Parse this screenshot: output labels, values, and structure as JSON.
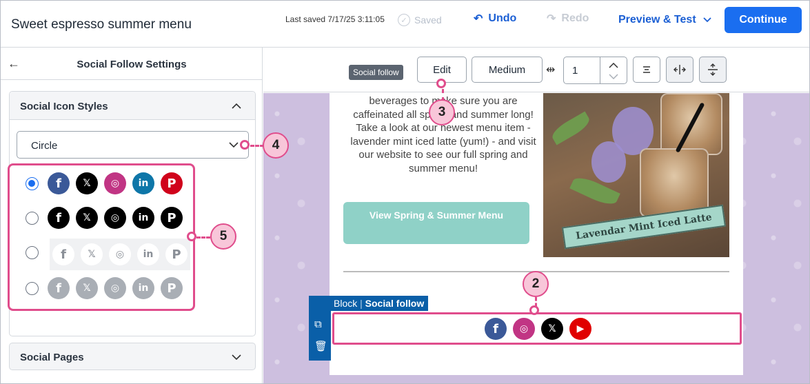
{
  "header": {
    "title": "Sweet espresso summer menu",
    "last_saved": "Last saved 7/17/25 3:11:05",
    "saved_label": "Saved",
    "undo_label": "Undo",
    "redo_label": "Redo",
    "preview_label": "Preview & Test",
    "continue_label": "Continue"
  },
  "left_panel": {
    "title": "Social Follow Settings",
    "icon_styles": {
      "title": "Social Icon Styles",
      "shape_select_value": "Circle",
      "selected_style_index": 0,
      "styles": [
        "color",
        "black",
        "light",
        "grey"
      ]
    },
    "social_pages_title": "Social Pages"
  },
  "toolbar": {
    "tag": "Social follow",
    "edit_label": "Edit",
    "size_label": "Medium",
    "padding_value": "1"
  },
  "email": {
    "body_text": "beverages to make sure you are caffeinated all spring and summer long! Take a look at our newest menu item - lavender mint iced latte (yum!) - and visit our website to see our full spring and summer menu!",
    "cta_label": "View Spring & Summer Menu",
    "image_banner": "Lavendar Mint Iced Latte",
    "block_label_prefix": "Block",
    "block_label_name": "Social follow",
    "social_icons": [
      "facebook",
      "instagram",
      "x",
      "youtube"
    ]
  },
  "callouts": [
    "2",
    "3",
    "4",
    "5"
  ],
  "colors": {
    "accent": "#1a6ef0",
    "callout": "#e04d8c",
    "facebook": "#3b5998",
    "instagram": "#c13584",
    "linkedin": "#0e76a8",
    "pinterest": "#d0021b",
    "youtube": "#e00000"
  }
}
